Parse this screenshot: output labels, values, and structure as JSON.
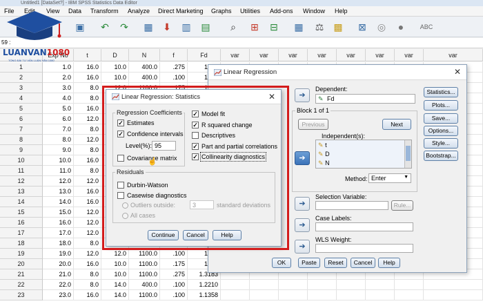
{
  "titlebar": {
    "text": "Untitled1 [DataSet?] - IBM SPSS Statistics Data Editor"
  },
  "logo": {
    "brand_blue": "LUANVAN",
    "brand_red": "1080",
    "tagline": "TỔNG ĐÀI TƯ VẤN LUẬN VĂN 1080"
  },
  "menu": {
    "items": [
      "File",
      "Edit",
      "View",
      "Data",
      "Transform",
      "Analyze",
      "Direct Marketing",
      "Graphs",
      "Utilities",
      "Add-ons",
      "Window",
      "Help"
    ]
  },
  "cellref": "59 :",
  "grid": {
    "columns": [
      "Exp No",
      "t",
      "D",
      "N",
      "f",
      "Fd",
      "var",
      "var",
      "var",
      "var",
      "var",
      "var",
      "var",
      "var"
    ],
    "rows": [
      [
        "1",
        "1.0",
        "16.0",
        "10.0",
        "400.0",
        ".275",
        "1.2..."
      ],
      [
        "2",
        "2.0",
        "16.0",
        "10.0",
        "400.0",
        ".100",
        "1.1..."
      ],
      [
        "3",
        "3.0",
        "8.0",
        "12.0",
        "1100.0",
        ".175",
        "1.1..."
      ],
      [
        "4",
        "4.0",
        "8.0",
        "",
        "",
        "",
        ""
      ],
      [
        "5",
        "5.0",
        "16.0",
        "",
        "",
        "",
        ""
      ],
      [
        "6",
        "6.0",
        "12.0",
        "",
        "",
        "",
        ""
      ],
      [
        "7",
        "7.0",
        "8.0",
        "",
        "",
        "",
        ""
      ],
      [
        "8",
        "8.0",
        "12.0",
        "",
        "",
        "",
        ""
      ],
      [
        "9",
        "9.0",
        "8.0",
        "",
        "",
        "",
        ""
      ],
      [
        "10",
        "10.0",
        "16.0",
        "",
        "",
        "",
        ""
      ],
      [
        "11",
        "11.0",
        "8.0",
        "",
        "",
        "",
        ""
      ],
      [
        "12",
        "12.0",
        "12.0",
        "",
        "",
        "",
        ""
      ],
      [
        "13",
        "13.0",
        "16.0",
        "",
        "",
        "",
        ""
      ],
      [
        "14",
        "14.0",
        "16.0",
        "",
        "",
        "",
        ""
      ],
      [
        "15",
        "15.0",
        "12.0",
        "",
        "",
        "",
        ""
      ],
      [
        "16",
        "16.0",
        "12.0",
        "",
        "",
        "",
        ""
      ],
      [
        "17",
        "17.0",
        "12.0",
        "",
        "",
        "",
        ""
      ],
      [
        "18",
        "18.0",
        "8.0",
        "14.0",
        "000.0",
        "",
        ""
      ],
      [
        "19",
        "19.0",
        "12.0",
        "12.0",
        "1100.0",
        ".100",
        "1.1..."
      ],
      [
        "20",
        "20.0",
        "16.0",
        "10.0",
        "1100.0",
        ".175",
        "1.1..."
      ],
      [
        "21",
        "21.0",
        "8.0",
        "10.0",
        "1100.0",
        ".275",
        "1.3183"
      ],
      [
        "22",
        "22.0",
        "8.0",
        "14.0",
        "400.0",
        ".100",
        "1.2210"
      ],
      [
        "23",
        "23.0",
        "16.0",
        "14.0",
        "1100.0",
        ".100",
        "1.1358"
      ]
    ]
  },
  "lr": {
    "title": "Linear Regression",
    "dependent_label": "Dependent:",
    "dependent_value": "Fd",
    "block_label": "Block 1 of 1",
    "previous": "Previous",
    "next": "Next",
    "independent_label": "Independent(s):",
    "independents": [
      "t",
      "D",
      "N"
    ],
    "method_label": "Method:",
    "method_value": "Enter",
    "selection_label": "Selection Variable:",
    "rule": "Rule...",
    "case_labels": "Case Labels:",
    "wls_label": "WLS Weight:",
    "side_buttons": [
      "Statistics...",
      "Plots...",
      "Save...",
      "Options...",
      "Style...",
      "Bootstrap..."
    ],
    "ok": "OK",
    "paste": "Paste",
    "reset": "Reset",
    "cancel": "Cancel",
    "help": "Help"
  },
  "stats": {
    "title": "Linear Regression: Statistics",
    "coef_group": "Regression Coefficients",
    "estimates": "Estimates",
    "confidence": "Confidence intervals",
    "level_label": "Level(%):",
    "level_value": "95",
    "covariance": "Covariance matrix",
    "model_fit": "Model fit",
    "r_squared": "R squared change",
    "descriptives": "Descriptives",
    "part_partial": "Part and partial correlations",
    "collinearity": "Collinearity diagnostics",
    "residuals_group": "Residuals",
    "durbin": "Durbin-Watson",
    "casewise": "Casewise diagnostics",
    "outliers": "Outliers outside:",
    "outliers_value": "3",
    "std_dev": "standard deviations",
    "all_cases": "All cases",
    "continue": "Continue",
    "cancel": "Cancel",
    "help": "Help"
  },
  "colors": {
    "highlight_frame": "#d31c1c",
    "accent_blue": "#3a72b8"
  }
}
